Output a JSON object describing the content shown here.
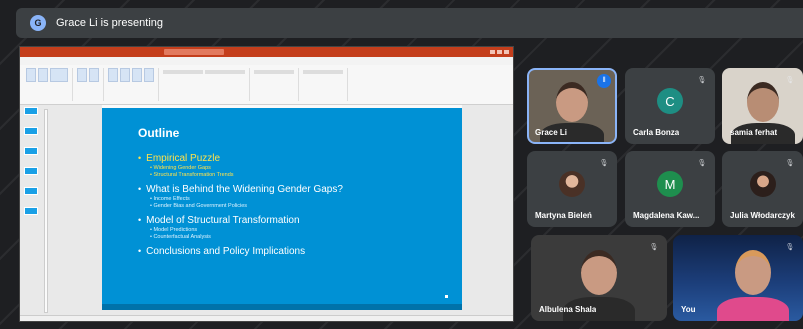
{
  "presenting": {
    "avatar_letter": "G",
    "text": "Grace Li is presenting"
  },
  "slide": {
    "title": "Outline",
    "sections": [
      {
        "heading": "Empirical Puzzle",
        "active": true,
        "subs": [
          "Widening Gender Gaps",
          "Structural Transformation Trends"
        ]
      },
      {
        "heading": "What is Behind the Widening Gender Gaps?",
        "active": false,
        "subs": [
          "Income Effects",
          "Gender Bias and Government Policies"
        ]
      },
      {
        "heading": "Model of Structural Transformation",
        "active": false,
        "subs": [
          "Model Predictions",
          "Counterfactual Analysis"
        ]
      },
      {
        "heading": "Conclusions and Policy Implications",
        "active": false,
        "subs": []
      }
    ]
  },
  "participants": [
    {
      "name": "Grace Li",
      "type": "video",
      "speaking": true
    },
    {
      "name": "Carla Bonza",
      "type": "letter",
      "letter": "C",
      "color": "#1e8e83",
      "muted": true
    },
    {
      "name": "samia ferhat",
      "type": "video",
      "muted": true
    },
    {
      "name": "Martyna Bieleń",
      "type": "photo",
      "muted": true
    },
    {
      "name": "Magdalena Kaw...",
      "type": "letter",
      "letter": "M",
      "color": "#1e8e4e",
      "muted": true
    },
    {
      "name": "Julia Włodarczyk",
      "type": "photo",
      "muted": true
    },
    {
      "name": "Albulena Shala",
      "type": "video",
      "muted": true
    },
    {
      "name": "You",
      "type": "video",
      "muted": true
    }
  ],
  "colors": {
    "slide_bg": "#0091d5",
    "highlight": "#ffe24a",
    "speaking": "#8ab4f8"
  }
}
